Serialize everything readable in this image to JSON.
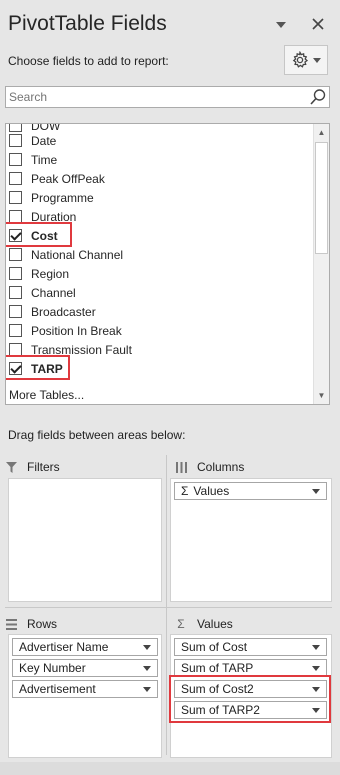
{
  "header": {
    "title": "PivotTable Fields",
    "subtitle": "Choose fields to add to report:",
    "dropdown_icon": "chevron-down-icon",
    "close_icon": "close-icon",
    "settings_icon": "gear-icon"
  },
  "search": {
    "placeholder": "Search",
    "icon": "search-icon"
  },
  "fields": [
    {
      "label": "DOW",
      "checked": false,
      "bold": false
    },
    {
      "label": "Date",
      "checked": false,
      "bold": false
    },
    {
      "label": "Time",
      "checked": false,
      "bold": false
    },
    {
      "label": "Peak OffPeak",
      "checked": false,
      "bold": false
    },
    {
      "label": "Programme",
      "checked": false,
      "bold": false
    },
    {
      "label": "Duration",
      "checked": false,
      "bold": false
    },
    {
      "label": "Cost",
      "checked": true,
      "bold": true
    },
    {
      "label": "National Channel",
      "checked": false,
      "bold": false
    },
    {
      "label": "Region",
      "checked": false,
      "bold": false
    },
    {
      "label": "Channel",
      "checked": false,
      "bold": false
    },
    {
      "label": "Broadcaster",
      "checked": false,
      "bold": false
    },
    {
      "label": "Position In Break",
      "checked": false,
      "bold": false
    },
    {
      "label": "Transmission Fault",
      "checked": false,
      "bold": false
    },
    {
      "label": "TARP",
      "checked": true,
      "bold": true
    }
  ],
  "more_tables": "More Tables...",
  "drag_text": "Drag fields between areas below:",
  "areas": {
    "filters": {
      "title": "Filters",
      "icon": "filter-icon",
      "items": []
    },
    "columns": {
      "title": "Columns",
      "icon": "columns-icon",
      "items": [
        "Values"
      ],
      "item_icon": "sigma-icon"
    },
    "rows": {
      "title": "Rows",
      "icon": "rows-icon",
      "items": [
        "Advertiser Name",
        "Key Number",
        "Advertisement"
      ]
    },
    "values": {
      "title": "Values",
      "icon": "sigma-icon",
      "items": [
        "Sum of Cost",
        "Sum of TARP",
        "Sum of Cost2",
        "Sum of TARP2"
      ]
    }
  },
  "colors": {
    "highlight": "#e0393e",
    "panel_bg": "#e6e6e6"
  }
}
